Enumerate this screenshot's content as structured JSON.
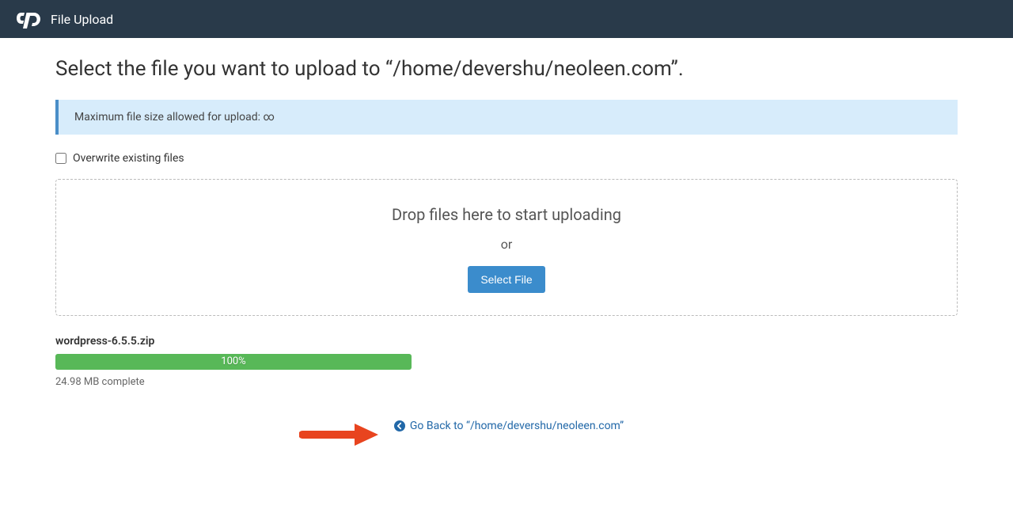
{
  "header": {
    "title": "File Upload"
  },
  "page": {
    "heading": "Select the file you want to upload to “/home/devershu/neoleen.com”.",
    "info_banner": "Maximum file size allowed for upload: ∞",
    "overwrite_label": "Overwrite existing files",
    "overwrite_checked": false
  },
  "dropzone": {
    "drop_text": "Drop files here to start uploading",
    "or_text": "or",
    "select_button": "Select File"
  },
  "uploads": [
    {
      "filename": "wordpress-6.5.5.zip",
      "percent": 100,
      "percent_label": "100%",
      "status_text": "24.98 MB complete"
    }
  ],
  "back_link": {
    "label": "Go Back to “/home/devershu/neoleen.com”"
  }
}
